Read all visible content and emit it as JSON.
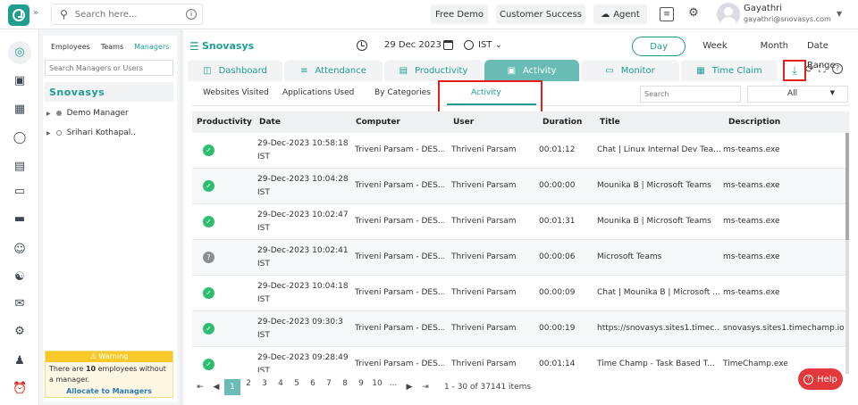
{
  "topbar": {
    "search_placeholder": "Search here...",
    "free_demo": "Free Demo",
    "customer_success": "Customer Success",
    "agent": "Agent",
    "user_name": "Gayathri",
    "user_email": "gayathri@snovasys.com"
  },
  "panel": {
    "tabs": [
      "Employees",
      "Teams",
      "Managers"
    ],
    "active_tab": "Managers",
    "search_placeholder": "Search Managers or Users",
    "org": "Snovasys",
    "tree": [
      "Demo Manager",
      "Srihari Kothapal.."
    ],
    "warning_title": "Warning",
    "warning_pre": "There are ",
    "warning_count": "10",
    "warning_post": " employees without a manager.",
    "allocate_link": "Allocate to Managers"
  },
  "main": {
    "org": "Snovasys",
    "date": "29 Dec 2023",
    "timezone": "IST",
    "ranges": [
      "Day",
      "Week",
      "Month",
      "Date Range"
    ],
    "active_range": "Day",
    "tabs": [
      "Dashboard",
      "Attendance",
      "Productivity",
      "Activity",
      "Monitor",
      "Time Claim"
    ],
    "active_tab": "Activity",
    "subtabs": [
      "Websites Visited",
      "Applications Used",
      "By Categories",
      "Activity"
    ],
    "active_subtab": "Activity",
    "search_placeholder": "Search",
    "filter_value": "All"
  },
  "table": {
    "headers": [
      "Productivity",
      "Date",
      "Computer",
      "User",
      "Duration",
      "Title",
      "Description"
    ],
    "rows": [
      {
        "status": "productive",
        "date": "29-Dec-2023 10:58:18",
        "tz": "IST",
        "computer": "Triveni Parsam - DES...",
        "user": "Thriveni Parsam",
        "duration": "00:01:12",
        "title": "Chat | Linux Internal Dev Tea...",
        "description": "ms-teams.exe"
      },
      {
        "status": "productive",
        "date": "29-Dec-2023 10:04:28",
        "tz": "IST",
        "computer": "Triveni Parsam - DES...",
        "user": "Thriveni Parsam",
        "duration": "00:00:00",
        "title": "Mounika B | Microsoft Teams",
        "description": "ms-teams.exe"
      },
      {
        "status": "productive",
        "date": "29-Dec-2023 10:02:47",
        "tz": "IST",
        "computer": "Triveni Parsam - DES...",
        "user": "Thriveni Parsam",
        "duration": "00:01:31",
        "title": "Mounika B | Microsoft Teams",
        "description": "ms-teams.exe"
      },
      {
        "status": "unknown",
        "date": "29-Dec-2023 10:02:41",
        "tz": "IST",
        "computer": "Triveni Parsam - DES...",
        "user": "Thriveni Parsam",
        "duration": "00:00:06",
        "title": "Microsoft Teams",
        "description": "ms-teams.exe"
      },
      {
        "status": "productive",
        "date": "29-Dec-2023 10:04:18",
        "tz": "IST",
        "computer": "Triveni Parsam - DES...",
        "user": "Thriveni Parsam",
        "duration": "00:00:09",
        "title": "Chat | Mounika B | Microsoft ...",
        "description": "ms-teams.exe"
      },
      {
        "status": "productive",
        "date": "29-Dec-2023 09:30:3",
        "tz": "IST",
        "computer": "Triveni Parsam - DES...",
        "user": "Thriveni Parsam",
        "duration": "00:00:19",
        "title": "https://snovasys.sites1.timec...",
        "description": "snovasys.sites1.timechamp.io"
      },
      {
        "status": "productive",
        "date": "29-Dec-2023 09:28:49",
        "tz": "IST",
        "computer": "Triveni Parsam - DES...",
        "user": "Thriveni Parsam",
        "duration": "00:01:14",
        "title": "Time Champ - Task Based T...",
        "description": "TimeChamp.exe"
      }
    ]
  },
  "pager": {
    "pages": [
      "1",
      "2",
      "3",
      "4",
      "5",
      "6",
      "7",
      "8",
      "9",
      "10",
      "..."
    ],
    "current": "1",
    "items_label": "1 - 30 of 37141 items"
  },
  "help": "Help",
  "icons": {
    "nav": [
      "dashboard-icon",
      "calendar-icon",
      "schedule-icon",
      "user-icon",
      "briefcase-icon",
      "monitor-icon",
      "card-icon",
      "users-icon",
      "team-icon",
      "mail-icon",
      "settings-icon",
      "person-icon",
      "alarm-icon"
    ]
  },
  "colors": {
    "accent": "#1f9e8f",
    "tab_active": "#69bcb6",
    "highlight": "#e41d1d",
    "productive": "#2ebd6f",
    "warning": "#f8c928"
  }
}
